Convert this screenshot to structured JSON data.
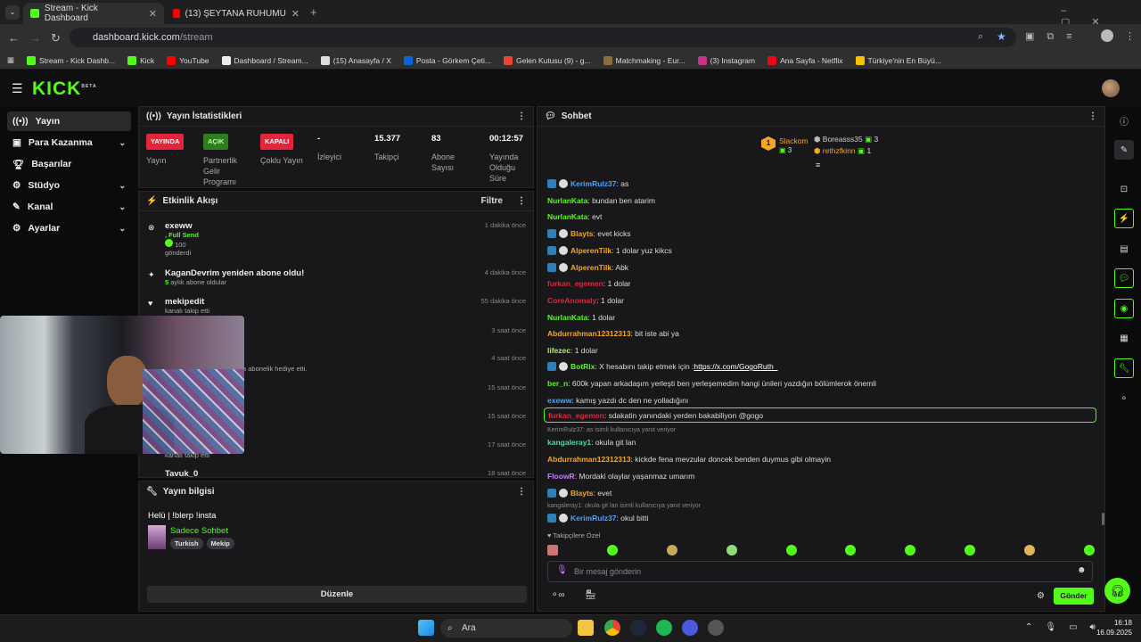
{
  "browser": {
    "tabs": [
      {
        "label": "Stream - Kick Dashboard",
        "active": true
      },
      {
        "label": "(13) ŞEYTANA RUHUMUZU SAT",
        "active": false
      }
    ],
    "url_domain": "dashboard.kick.com",
    "url_path": "/stream",
    "bookmarks": [
      "Stream - Kick Dashb...",
      "Kick",
      "YouTube",
      "Dashboard / Stream...",
      "(15) Anasayfa / X",
      "Posta - Görkem Çeti...",
      "Gelen Kutusu (9) - g...",
      "Matchmaking - Eur...",
      "(3) Instagram",
      "Ana Sayfa - Netflix",
      "Türkiye'nin En Büyü..."
    ]
  },
  "app": {
    "logo": "KICK",
    "logo_sup": "BETA"
  },
  "sidebar": {
    "items": [
      {
        "label": "Yayın"
      },
      {
        "label": "Para Kazanma"
      },
      {
        "label": "Başarılar"
      },
      {
        "label": "Stüdyo"
      },
      {
        "label": "Kanal"
      },
      {
        "label": "Ayarlar"
      }
    ]
  },
  "stats": {
    "title": "Yayın İstatistikleri",
    "items": [
      {
        "badge": "YAYINDA",
        "label": "Yayın"
      },
      {
        "badge": "AÇIK",
        "label": "Partnerlik Gelir Programı"
      },
      {
        "badge": "KAPALI",
        "label": "Çoklu Yayın"
      },
      {
        "value": "-",
        "label": "İzleyici"
      },
      {
        "value": "15.377",
        "label": "Takipçi"
      },
      {
        "value": "83",
        "label": "Abone Sayısı"
      },
      {
        "value": "00:12:57",
        "label": "Yayında Olduğu Süre"
      }
    ]
  },
  "activity": {
    "title": "Etkinlik Akışı",
    "filter": "Filtre",
    "items": [
      {
        "name": "exeww",
        "detail1": ", Full Send",
        "detail2": "100",
        "detail3": "gönderdi",
        "time": "1 dakika önce"
      },
      {
        "name": "KaganDevrim yeniden abone oldu!",
        "detail1": "5",
        "detail2": "aylık abone oldular",
        "time": "4 dakika önce"
      },
      {
        "name": "mekipedit",
        "detail1": "kanalı takip etti",
        "time": "55 dakika önce"
      },
      {
        "time": "3 saat önce"
      },
      {
        "detail1": "a abonelik hediye etti.",
        "time": "4 saat önce"
      },
      {
        "time": "15 saat önce"
      },
      {
        "time": "15 saat önce"
      },
      {
        "detail1": "kanalı takip etti",
        "time": "17 saat önce"
      },
      {
        "name": "Tavuk_0",
        "time": "18 saat önce"
      }
    ]
  },
  "info": {
    "title": "Yayın bilgisi",
    "stream_title": "Helü | !blerp !insta",
    "category": "Sadece Sohbet",
    "tags": [
      "Turkish",
      "Mekip"
    ],
    "edit": "Düzenle"
  },
  "chat": {
    "title": "Sohbet",
    "leaders": [
      {
        "rank": "1",
        "name": "Slackom",
        "count": "3"
      },
      {
        "name": "Boreasss35",
        "count": "3"
      },
      {
        "name": "rethzfkinn",
        "count": "1"
      }
    ],
    "messages": [
      {
        "user": "KerimRulz37",
        "color": "#4aa3ff",
        "text": ": as",
        "badges": true
      },
      {
        "user": "NurlanKata",
        "color": "#53fc18",
        "text": ": bundan ben atarim"
      },
      {
        "user": "NurlanKata",
        "color": "#53fc18",
        "text": ": evt"
      },
      {
        "user": "Blayts",
        "color": "#f5a623",
        "text": ": evet kicks",
        "badges": true
      },
      {
        "user": "AlperenTilk",
        "color": "#f5a623",
        "text": ": 1 dolar yuz kikcs",
        "badges": true
      },
      {
        "user": "AlperenTilk",
        "color": "#f5a623",
        "text": ": Abk",
        "badges": true
      },
      {
        "user": "furkan_egemen",
        "color": "#e3253b",
        "text": ": 1 dolar"
      },
      {
        "user": "CoreAnomaly",
        "color": "#e3253b",
        "text": ": 1 dolar"
      },
      {
        "user": "NurlanKata",
        "color": "#53fc18",
        "text": ": 1 dolar"
      },
      {
        "user": "Abdurrahman12312313",
        "color": "#f5a623",
        "text": ": bit iste abi ya"
      },
      {
        "user": "lifezec",
        "color": "#b5e86e",
        "text": ": 1 dolar"
      },
      {
        "user": "BotRix",
        "color": "#53fc18",
        "text": ": X hesabını takip etmek için : ",
        "link": "https://x.com/GogoRuth_",
        "badges": true
      },
      {
        "user": "ber_n",
        "color": "#53fc18",
        "text": ": 600k yapan arkadaşım yerleşti ben yerleşemedim hangi ünileri yazdığın bölümlerok önemli"
      },
      {
        "user": "exeww",
        "color": "#4aa3ff",
        "text": ": kamış yazdı dc den ne yolladığını"
      },
      {
        "user": "furkan_egemen",
        "color": "#e3253b",
        "text": ": sdakatin yanındaki yerden bakabiliyon @gogo",
        "highlight": true
      },
      {
        "user": "kangaleray1",
        "color": "#4ad9a0",
        "text": ": okula git lan",
        "reply": "KerimRulz37: as isimli kullanıcıya yanıt veriyor"
      },
      {
        "user": "Abdurrahman12312313",
        "color": "#f5a623",
        "text": ": kickde fena mevzular doncek benden duymus gibi olmayin"
      },
      {
        "user": "FloowR",
        "color": "#c77dff",
        "text": ": Mordaki olaylar yaşanmaz umarım"
      },
      {
        "user": "Blayts",
        "color": "#f5a623",
        "text": ": evet",
        "badges": true
      },
      {
        "user": "KerimRulz37",
        "color": "#4aa3ff",
        "text": ": okul bitti",
        "badges": true,
        "reply": "kangaleray1: okula git lan isimli kullanıcıya yanıt veriyor"
      }
    ],
    "followers_only": "Takipçilere Özel",
    "input_placeholder": "Bir mesaj gönderin",
    "send": "Gönder"
  },
  "taskbar": {
    "search": "Ara",
    "time": "16:18",
    "date": "16.09.2025"
  }
}
